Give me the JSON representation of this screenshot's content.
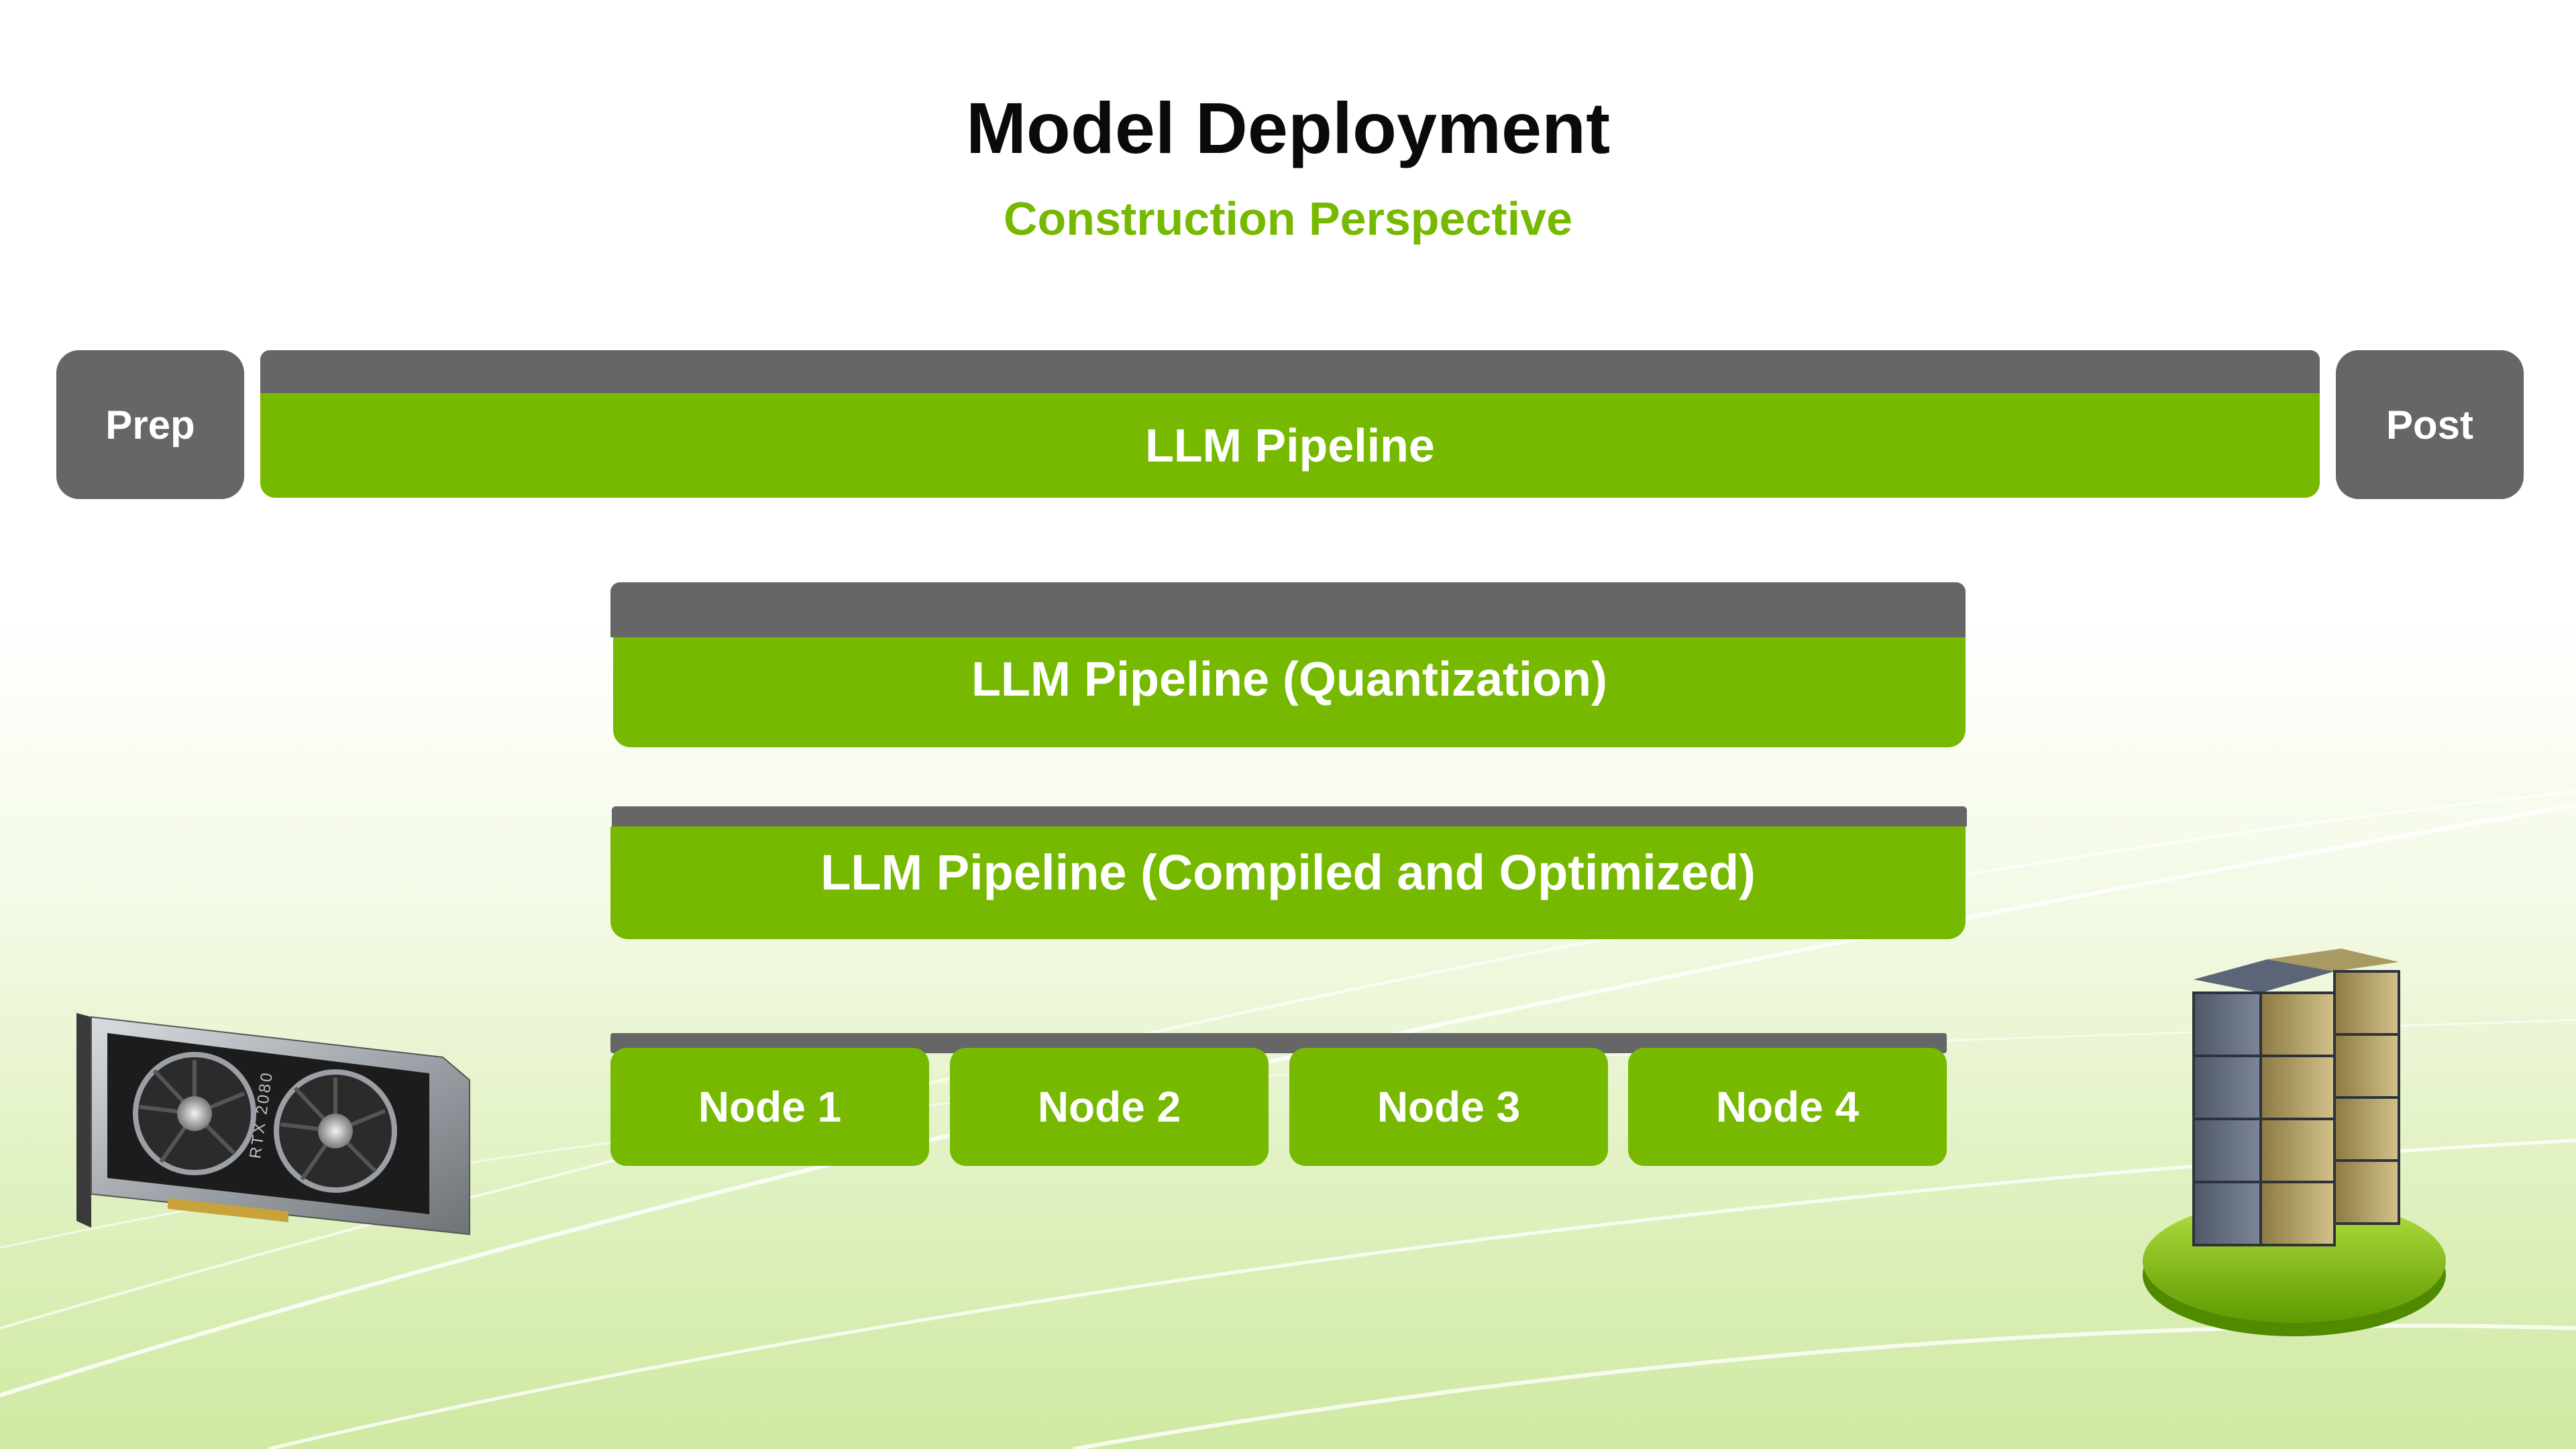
{
  "header": {
    "title": "Model Deployment",
    "subtitle": "Construction Perspective"
  },
  "pipeline_row": {
    "prep": "Prep",
    "main": "LLM Pipeline",
    "post": "Post"
  },
  "stages": {
    "quantization": "LLM Pipeline (Quantization)",
    "compiled": "LLM Pipeline (Compiled and Optimized)"
  },
  "nodes": [
    "Node 1",
    "Node 2",
    "Node 3",
    "Node 4"
  ],
  "gpu_card": {
    "label": "RTX 2080"
  },
  "colors": {
    "accent_green": "#76b900",
    "bar_gray": "#666666",
    "title": "#0a0a0a"
  }
}
